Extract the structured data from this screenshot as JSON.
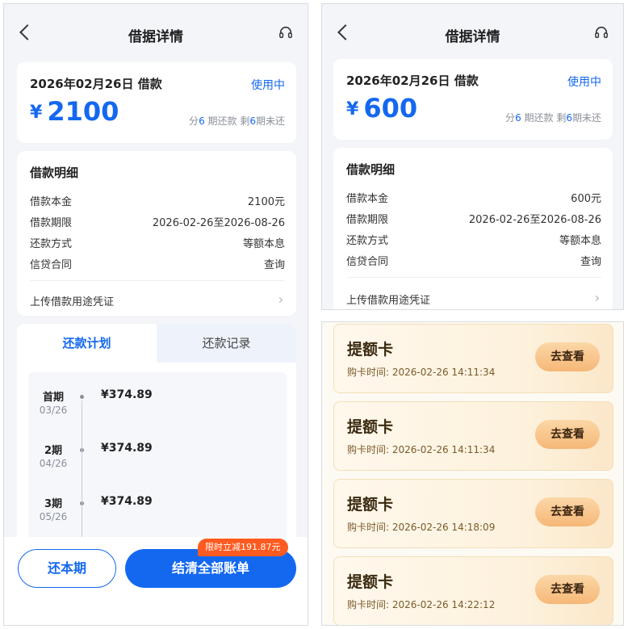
{
  "left": {
    "header": {
      "title": "借据详情"
    },
    "summary": {
      "date_label": "2026年02月26日 借款",
      "status": "使用中",
      "currency": "¥",
      "amount": "2100",
      "periods_prefix": "分",
      "periods_total": "6",
      "periods_mid": " 期还款 剩",
      "periods_left": "6",
      "periods_suffix": "期未还"
    },
    "detail": {
      "title": "借款明细",
      "rows": [
        {
          "label": "借款本金",
          "value": "2100元"
        },
        {
          "label": "借款期限",
          "value": "2026-02-26至2026-08-26"
        },
        {
          "label": "还款方式",
          "value": "等额本息"
        },
        {
          "label": "信贷合同",
          "value": "查询"
        }
      ],
      "upload_label": "上传借款用途凭证"
    },
    "tabs": {
      "plan": "还款计划",
      "record": "还款记录"
    },
    "plan": [
      {
        "term": "首期",
        "date": "03/26",
        "amount": "¥374.89"
      },
      {
        "term": "2期",
        "date": "04/26",
        "amount": "¥374.89"
      },
      {
        "term": "3期",
        "date": "05/26",
        "amount": "¥374.89"
      }
    ],
    "buttons": {
      "repay_current": "还本期",
      "settle_all": "结清全部账单",
      "promo": "限时立减191.87元"
    }
  },
  "right": {
    "header": {
      "title": "借据详情"
    },
    "summary": {
      "date_label": "2026年02月26日 借款",
      "status": "使用中",
      "currency": "¥",
      "amount": "600",
      "periods_prefix": "分",
      "periods_total": "6",
      "periods_mid": " 期还款 剩",
      "periods_left": "6",
      "periods_suffix": "期未还"
    },
    "detail": {
      "title": "借款明细",
      "rows": [
        {
          "label": "借款本金",
          "value": "600元"
        },
        {
          "label": "借款期限",
          "value": "2026-02-26至2026-08-26"
        },
        {
          "label": "还款方式",
          "value": "等额本息"
        },
        {
          "label": "信贷合同",
          "value": "查询"
        }
      ],
      "upload_label": "上传借款用途凭证"
    }
  },
  "cards": [
    {
      "title": "提额卡",
      "time_label": "购卡时间:",
      "time": "2026-02-26 14:11:34",
      "button": "去查看"
    },
    {
      "title": "提额卡",
      "time_label": "购卡时间:",
      "time": "2026-02-26 14:11:34",
      "button": "去查看"
    },
    {
      "title": "提额卡",
      "time_label": "购卡时间:",
      "time": "2026-02-26 14:18:09",
      "button": "去查看"
    },
    {
      "title": "提额卡",
      "time_label": "购卡时间:",
      "time": "2026-02-26 14:22:12",
      "button": "去查看"
    }
  ],
  "colors": {
    "accent": "#1468f0",
    "promo": "#ff5a1f",
    "card_gold": "#f6b777"
  }
}
